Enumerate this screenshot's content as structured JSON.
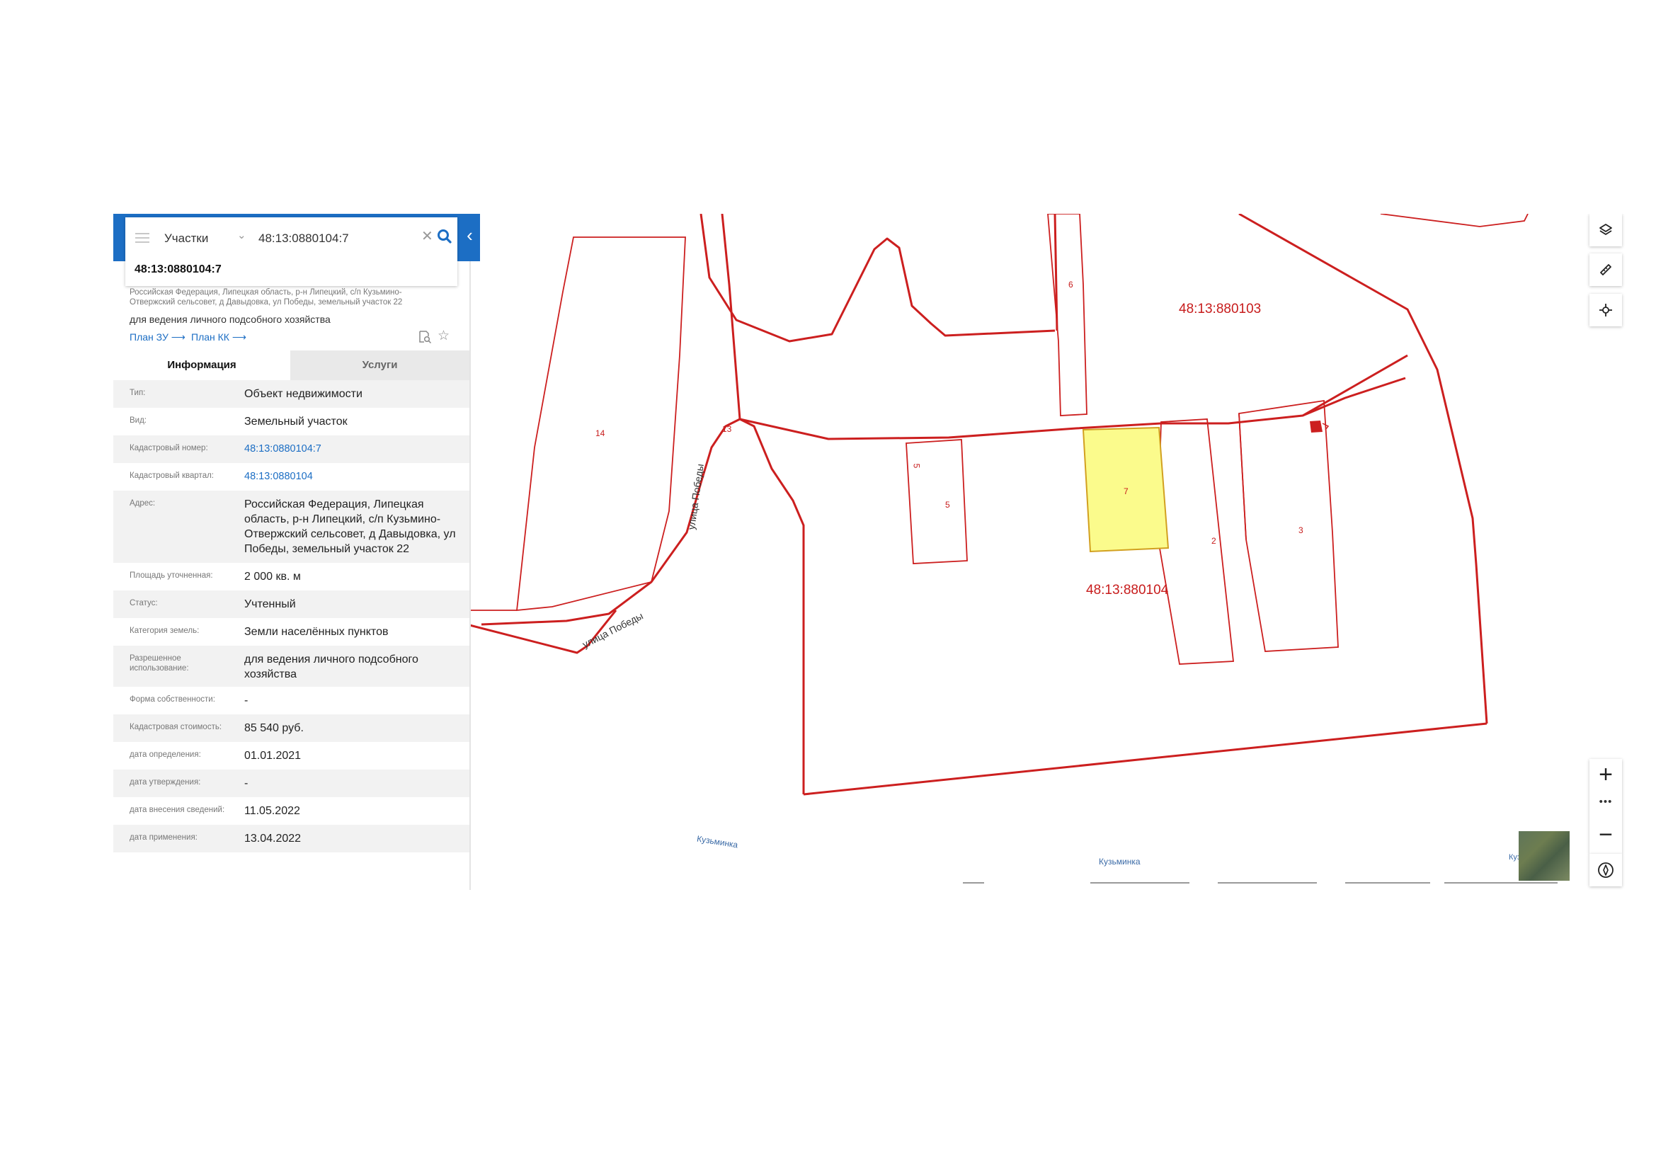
{
  "search": {
    "type_label": "Участки",
    "value": "48:13:0880104:7"
  },
  "result": {
    "title": "48:13:0880104:7",
    "address_short": "Российская Федерация, Липецкая область, р-н Липецкий, с/п Кузьмино-Отвержский сельсовет, д Давыдовка, ул Победы, земельный участок 22",
    "purpose": "для ведения личного подсобного хозяйства",
    "plan_zu": "План ЗУ ⟶",
    "plan_kk": "План КК ⟶"
  },
  "tabs": {
    "info": "Информация",
    "services": "Услуги"
  },
  "info_rows": [
    {
      "label": "Тип:",
      "value": "Объект недвижимости"
    },
    {
      "label": "Вид:",
      "value": "Земельный участок"
    },
    {
      "label": "Кадастровый номер:",
      "value": "48:13:0880104:7"
    },
    {
      "label": "Кадастровый квартал:",
      "value": "48:13:0880104"
    },
    {
      "label": "Адрес:",
      "value": "Российская Федерация, Липецкая область, р-н Липецкий, с/п Кузьмино-Отвержский сельсовет, д Давыдовка, ул Победы, земельный участок 22"
    },
    {
      "label": "Площадь уточненная:",
      "value": "2 000 кв. м"
    },
    {
      "label": "Статус:",
      "value": "Учтенный"
    },
    {
      "label": "Категория земель:",
      "value": "Земли населённых пунктов"
    },
    {
      "label": "Разрешенное использование:",
      "value": "для ведения личного подсобного хозяйства"
    },
    {
      "label": "Форма собственности:",
      "value": "-"
    },
    {
      "label": "Кадастровая стоимость:",
      "value": "85 540 руб."
    },
    {
      "label": "дата определения:",
      "value": "01.01.2021"
    },
    {
      "label": "дата утверждения:",
      "value": "-"
    },
    {
      "label": "дата внесения сведений:",
      "value": "11.05.2022"
    },
    {
      "label": "дата применения:",
      "value": "13.04.2022"
    }
  ],
  "map": {
    "quarter_103": "48:13:880103",
    "quarter_104": "48:13:880104",
    "parcels": [
      "14",
      "13",
      "6",
      "5",
      "7",
      "2",
      "3",
      "5"
    ],
    "street_1": "улица Победы",
    "street_2": "улица Победы",
    "place_1": "Кузьминка",
    "place_2": "Кузьминка",
    "place_3": "Куз",
    "highlight_color": "#fbfb8c",
    "boundary_color": "#cc1f1f"
  },
  "zoom": {
    "plus": "+",
    "dots": "•••",
    "minus": "−"
  }
}
